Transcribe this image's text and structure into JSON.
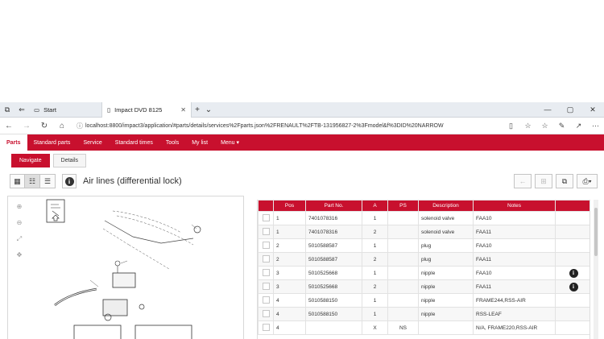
{
  "browser": {
    "tabs": [
      {
        "label": "Start",
        "icon": "start-icon"
      },
      {
        "label": "Impact DVD 8125",
        "icon": "page-icon"
      }
    ],
    "url": "localhost:8800/impact3/application/#parts/details/services%2Fparts.json%2FRENAULT%2FTB-131956827-2%3Fmodel&f%3DID%20NARROW"
  },
  "menu": {
    "items": [
      "Parts",
      "Standard parts",
      "Service",
      "Standard times",
      "Tools",
      "My list",
      "Menu ▾"
    ],
    "active_index": 0
  },
  "subtabs": [
    "Navigate",
    "Details"
  ],
  "toolbar": {
    "title": "Air lines (differential lock)"
  },
  "parts_table": {
    "headers": [
      "",
      "Pos",
      "Part No.",
      "A",
      "PS",
      "Description",
      "Notes",
      ""
    ],
    "rows": [
      {
        "pos": "1",
        "part_no": "7401078316",
        "a": "1",
        "ps": "",
        "description": "solenoid valve",
        "notes": "FAA10",
        "info": false
      },
      {
        "pos": "1",
        "part_no": "7401078316",
        "a": "2",
        "ps": "",
        "description": "solenoid valve",
        "notes": "FAA11",
        "info": false
      },
      {
        "pos": "2",
        "part_no": "5010588587",
        "a": "1",
        "ps": "",
        "description": "plug",
        "notes": "FAA10",
        "info": false
      },
      {
        "pos": "2",
        "part_no": "5010588587",
        "a": "2",
        "ps": "",
        "description": "plug",
        "notes": "FAA11",
        "info": false
      },
      {
        "pos": "3",
        "part_no": "5010525668",
        "a": "1",
        "ps": "",
        "description": "nipple",
        "notes": "FAA10",
        "info": true
      },
      {
        "pos": "3",
        "part_no": "5010525668",
        "a": "2",
        "ps": "",
        "description": "nipple",
        "notes": "FAA11",
        "info": true
      },
      {
        "pos": "4",
        "part_no": "5010588150",
        "a": "1",
        "ps": "",
        "description": "nipple",
        "notes": "FRAME244,RSS-AIR",
        "info": false
      },
      {
        "pos": "4",
        "part_no": "5010588150",
        "a": "1",
        "ps": "",
        "description": "nipple",
        "notes": "RSS-LEAF",
        "info": false
      },
      {
        "pos": "4",
        "part_no": "",
        "a": "X",
        "ps": "NS",
        "description": "",
        "notes": "N/A, FRAME220,RSS-AIR",
        "info": false
      }
    ]
  },
  "colors": {
    "brand_red": "#c8102e",
    "browser_chrome": "#e8ecf1"
  }
}
